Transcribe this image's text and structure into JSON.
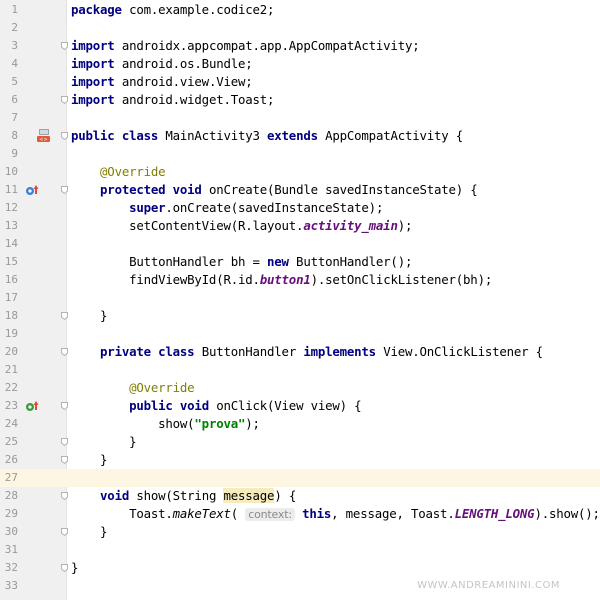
{
  "editor": {
    "lines": [
      {
        "n": "1",
        "code": [
          {
            "t": "package",
            "c": "kw"
          },
          {
            "t": " com.example.codice2;"
          }
        ]
      },
      {
        "n": "2",
        "code": []
      },
      {
        "n": "3",
        "code": [
          {
            "t": "import",
            "c": "kw"
          },
          {
            "t": " androidx.appcompat.app.AppCompatActivity;"
          }
        ]
      },
      {
        "n": "4",
        "code": [
          {
            "t": "import",
            "c": "kw"
          },
          {
            "t": " android.os.Bundle;"
          }
        ]
      },
      {
        "n": "5",
        "code": [
          {
            "t": "import",
            "c": "kw"
          },
          {
            "t": " android.view.View;"
          }
        ]
      },
      {
        "n": "6",
        "code": [
          {
            "t": "import",
            "c": "kw"
          },
          {
            "t": " android.widget.Toast;"
          }
        ]
      },
      {
        "n": "7",
        "code": []
      },
      {
        "n": "8",
        "code": [
          {
            "t": "public class",
            "c": "kw"
          },
          {
            "t": " MainActivity3 "
          },
          {
            "t": "extends",
            "c": "kw"
          },
          {
            "t": " AppCompatActivity {"
          }
        ]
      },
      {
        "n": "9",
        "code": []
      },
      {
        "n": "10",
        "code": [
          {
            "t": "    "
          },
          {
            "t": "@Override",
            "c": "ann"
          }
        ]
      },
      {
        "n": "11",
        "code": [
          {
            "t": "    "
          },
          {
            "t": "protected void",
            "c": "kw"
          },
          {
            "t": " onCreate(Bundle savedInstanceState) {"
          }
        ]
      },
      {
        "n": "12",
        "code": [
          {
            "t": "        "
          },
          {
            "t": "super",
            "c": "kw"
          },
          {
            "t": ".onCreate(savedInstanceState);"
          }
        ]
      },
      {
        "n": "13",
        "code": [
          {
            "t": "        setContentView(R.layout."
          },
          {
            "t": "activity_main",
            "c": "fld"
          },
          {
            "t": ");"
          }
        ]
      },
      {
        "n": "14",
        "code": []
      },
      {
        "n": "15",
        "code": [
          {
            "t": "        ButtonHandler bh = "
          },
          {
            "t": "new",
            "c": "kw"
          },
          {
            "t": " ButtonHandler();"
          }
        ]
      },
      {
        "n": "16",
        "code": [
          {
            "t": "        findViewById(R.id."
          },
          {
            "t": "button1",
            "c": "fld"
          },
          {
            "t": ").setOnClickListener(bh);"
          }
        ]
      },
      {
        "n": "17",
        "code": []
      },
      {
        "n": "18",
        "code": [
          {
            "t": "    }"
          }
        ]
      },
      {
        "n": "19",
        "code": []
      },
      {
        "n": "20",
        "code": [
          {
            "t": "    "
          },
          {
            "t": "private class",
            "c": "kw"
          },
          {
            "t": " ButtonHandler "
          },
          {
            "t": "implements",
            "c": "kw"
          },
          {
            "t": " View.OnClickListener {"
          }
        ]
      },
      {
        "n": "21",
        "code": []
      },
      {
        "n": "22",
        "code": [
          {
            "t": "        "
          },
          {
            "t": "@Override",
            "c": "ann"
          }
        ]
      },
      {
        "n": "23",
        "code": [
          {
            "t": "        "
          },
          {
            "t": "public void",
            "c": "kw"
          },
          {
            "t": " onClick(View view) {"
          }
        ]
      },
      {
        "n": "24",
        "code": [
          {
            "t": "            show("
          },
          {
            "t": "\"prova\"",
            "c": "str"
          },
          {
            "t": ");"
          }
        ]
      },
      {
        "n": "25",
        "code": [
          {
            "t": "        }"
          }
        ]
      },
      {
        "n": "26",
        "code": [
          {
            "t": "    }"
          }
        ]
      },
      {
        "n": "27",
        "code": []
      },
      {
        "n": "28",
        "code": [
          {
            "t": "    "
          },
          {
            "t": "void",
            "c": "kw"
          },
          {
            "t": " show(String "
          },
          {
            "t": "message",
            "c": "hl"
          },
          {
            "t": ") {"
          }
        ]
      },
      {
        "n": "29",
        "code": [
          {
            "t": "        Toast."
          },
          {
            "t": "makeText",
            "c": "italic"
          },
          {
            "t": "( "
          },
          {
            "t": "context:",
            "c": "hint"
          },
          {
            "t": " "
          },
          {
            "t": "this",
            "c": "kw"
          },
          {
            "t": ", message, Toast."
          },
          {
            "t": "LENGTH_LONG",
            "c": "fld"
          },
          {
            "t": ").show();"
          }
        ]
      },
      {
        "n": "30",
        "code": [
          {
            "t": "    }"
          }
        ]
      },
      {
        "n": "31",
        "code": []
      },
      {
        "n": "32",
        "code": [
          {
            "t": "}"
          }
        ]
      },
      {
        "n": "33",
        "code": []
      }
    ],
    "current_line": "27",
    "fold_lines": [
      "3",
      "6",
      "8",
      "11",
      "18",
      "20",
      "23",
      "25",
      "26",
      "28",
      "30",
      "32"
    ],
    "gutter_icons": [
      {
        "line": "8",
        "icon": "layout-file-icon"
      },
      {
        "line": "11",
        "icon": "override-method-icon"
      },
      {
        "line": "23",
        "icon": "implement-method-icon"
      }
    ]
  },
  "watermark": "WWW.ANDREAMININI.COM",
  "colors": {
    "keyword": "#000080",
    "annotation": "#808000",
    "string": "#008000",
    "field": "#660e7a",
    "gutter_bg": "#f0f0f0",
    "current_line_bg": "#fdf6e3"
  }
}
